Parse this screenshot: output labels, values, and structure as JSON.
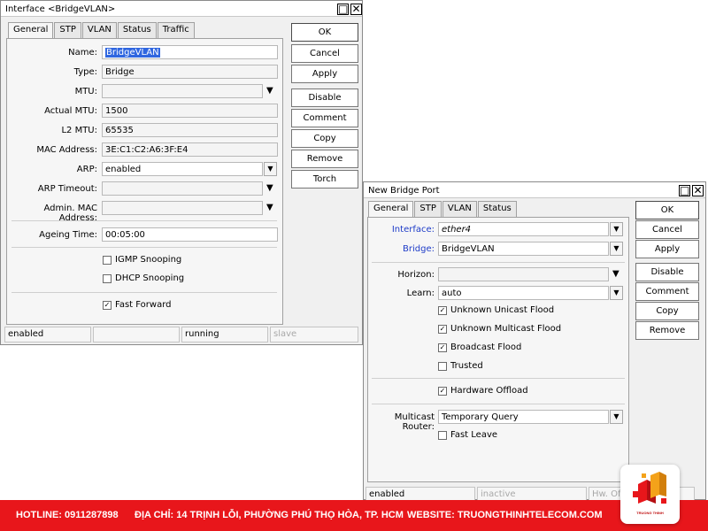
{
  "interface_window": {
    "title": "Interface <BridgeVLAN>",
    "tabs": [
      "General",
      "STP",
      "VLAN",
      "Status",
      "Traffic"
    ],
    "fields": {
      "name_label": "Name:",
      "name_value": "BridgeVLAN",
      "type_label": "Type:",
      "type_value": "Bridge",
      "mtu_label": "MTU:",
      "mtu_value": "",
      "actual_mtu_label": "Actual MTU:",
      "actual_mtu_value": "1500",
      "l2mtu_label": "L2 MTU:",
      "l2mtu_value": "65535",
      "mac_label": "MAC Address:",
      "mac_value": "3E:C1:C2:A6:3F:E4",
      "arp_label": "ARP:",
      "arp_value": "enabled",
      "arp_timeout_label": "ARP Timeout:",
      "arp_timeout_value": "",
      "admin_mac_label": "Admin. MAC Address:",
      "admin_mac_value": "",
      "ageing_label": "Ageing Time:",
      "ageing_value": "00:05:00"
    },
    "checkboxes": {
      "igmp": {
        "label": "IGMP Snooping",
        "checked": false
      },
      "dhcp": {
        "label": "DHCP Snooping",
        "checked": false
      },
      "fast_forward": {
        "label": "Fast Forward",
        "checked": true
      }
    },
    "buttons": [
      "OK",
      "Cancel",
      "Apply",
      "Disable",
      "Comment",
      "Copy",
      "Remove",
      "Torch"
    ],
    "status": [
      "enabled",
      "",
      "running",
      "slave"
    ]
  },
  "bridge_port_window": {
    "title": "New Bridge Port",
    "tabs": [
      "General",
      "STP",
      "VLAN",
      "Status"
    ],
    "fields": {
      "interface_label": "Interface:",
      "interface_value": "ether4",
      "bridge_label": "Bridge:",
      "bridge_value": "BridgeVLAN",
      "horizon_label": "Horizon:",
      "horizon_value": "",
      "learn_label": "Learn:",
      "learn_value": "auto",
      "multicast_router_label": "Multicast Router:",
      "multicast_router_value": "Temporary Query"
    },
    "checkboxes": {
      "unknown_unicast": {
        "label": "Unknown Unicast Flood",
        "checked": true
      },
      "unknown_multicast": {
        "label": "Unknown Multicast Flood",
        "checked": true
      },
      "broadcast": {
        "label": "Broadcast Flood",
        "checked": true
      },
      "trusted": {
        "label": "Trusted",
        "checked": false
      },
      "hw_offload": {
        "label": "Hardware Offload",
        "checked": true
      },
      "fast_leave": {
        "label": "Fast Leave",
        "checked": false
      }
    },
    "buttons": [
      "OK",
      "Cancel",
      "Apply",
      "Disable",
      "Comment",
      "Copy",
      "Remove"
    ],
    "status": [
      "enabled",
      "inactive",
      "Hw. Off"
    ]
  },
  "footer": {
    "hotline": "HOTLINE: 0911287898",
    "address": "ĐỊA CHỈ: 14 TRỊNH LỖI, PHƯỜNG PHÚ THỌ HÒA, TP. HCM",
    "website": "WEBSITE: TRUONGTHINHTELECOM.COM",
    "logo_text": "TRUONG THINH"
  },
  "colors": {
    "footer_bg": "#e8161b",
    "selection": "#2f66e0",
    "link_label": "#1e3cc8"
  }
}
